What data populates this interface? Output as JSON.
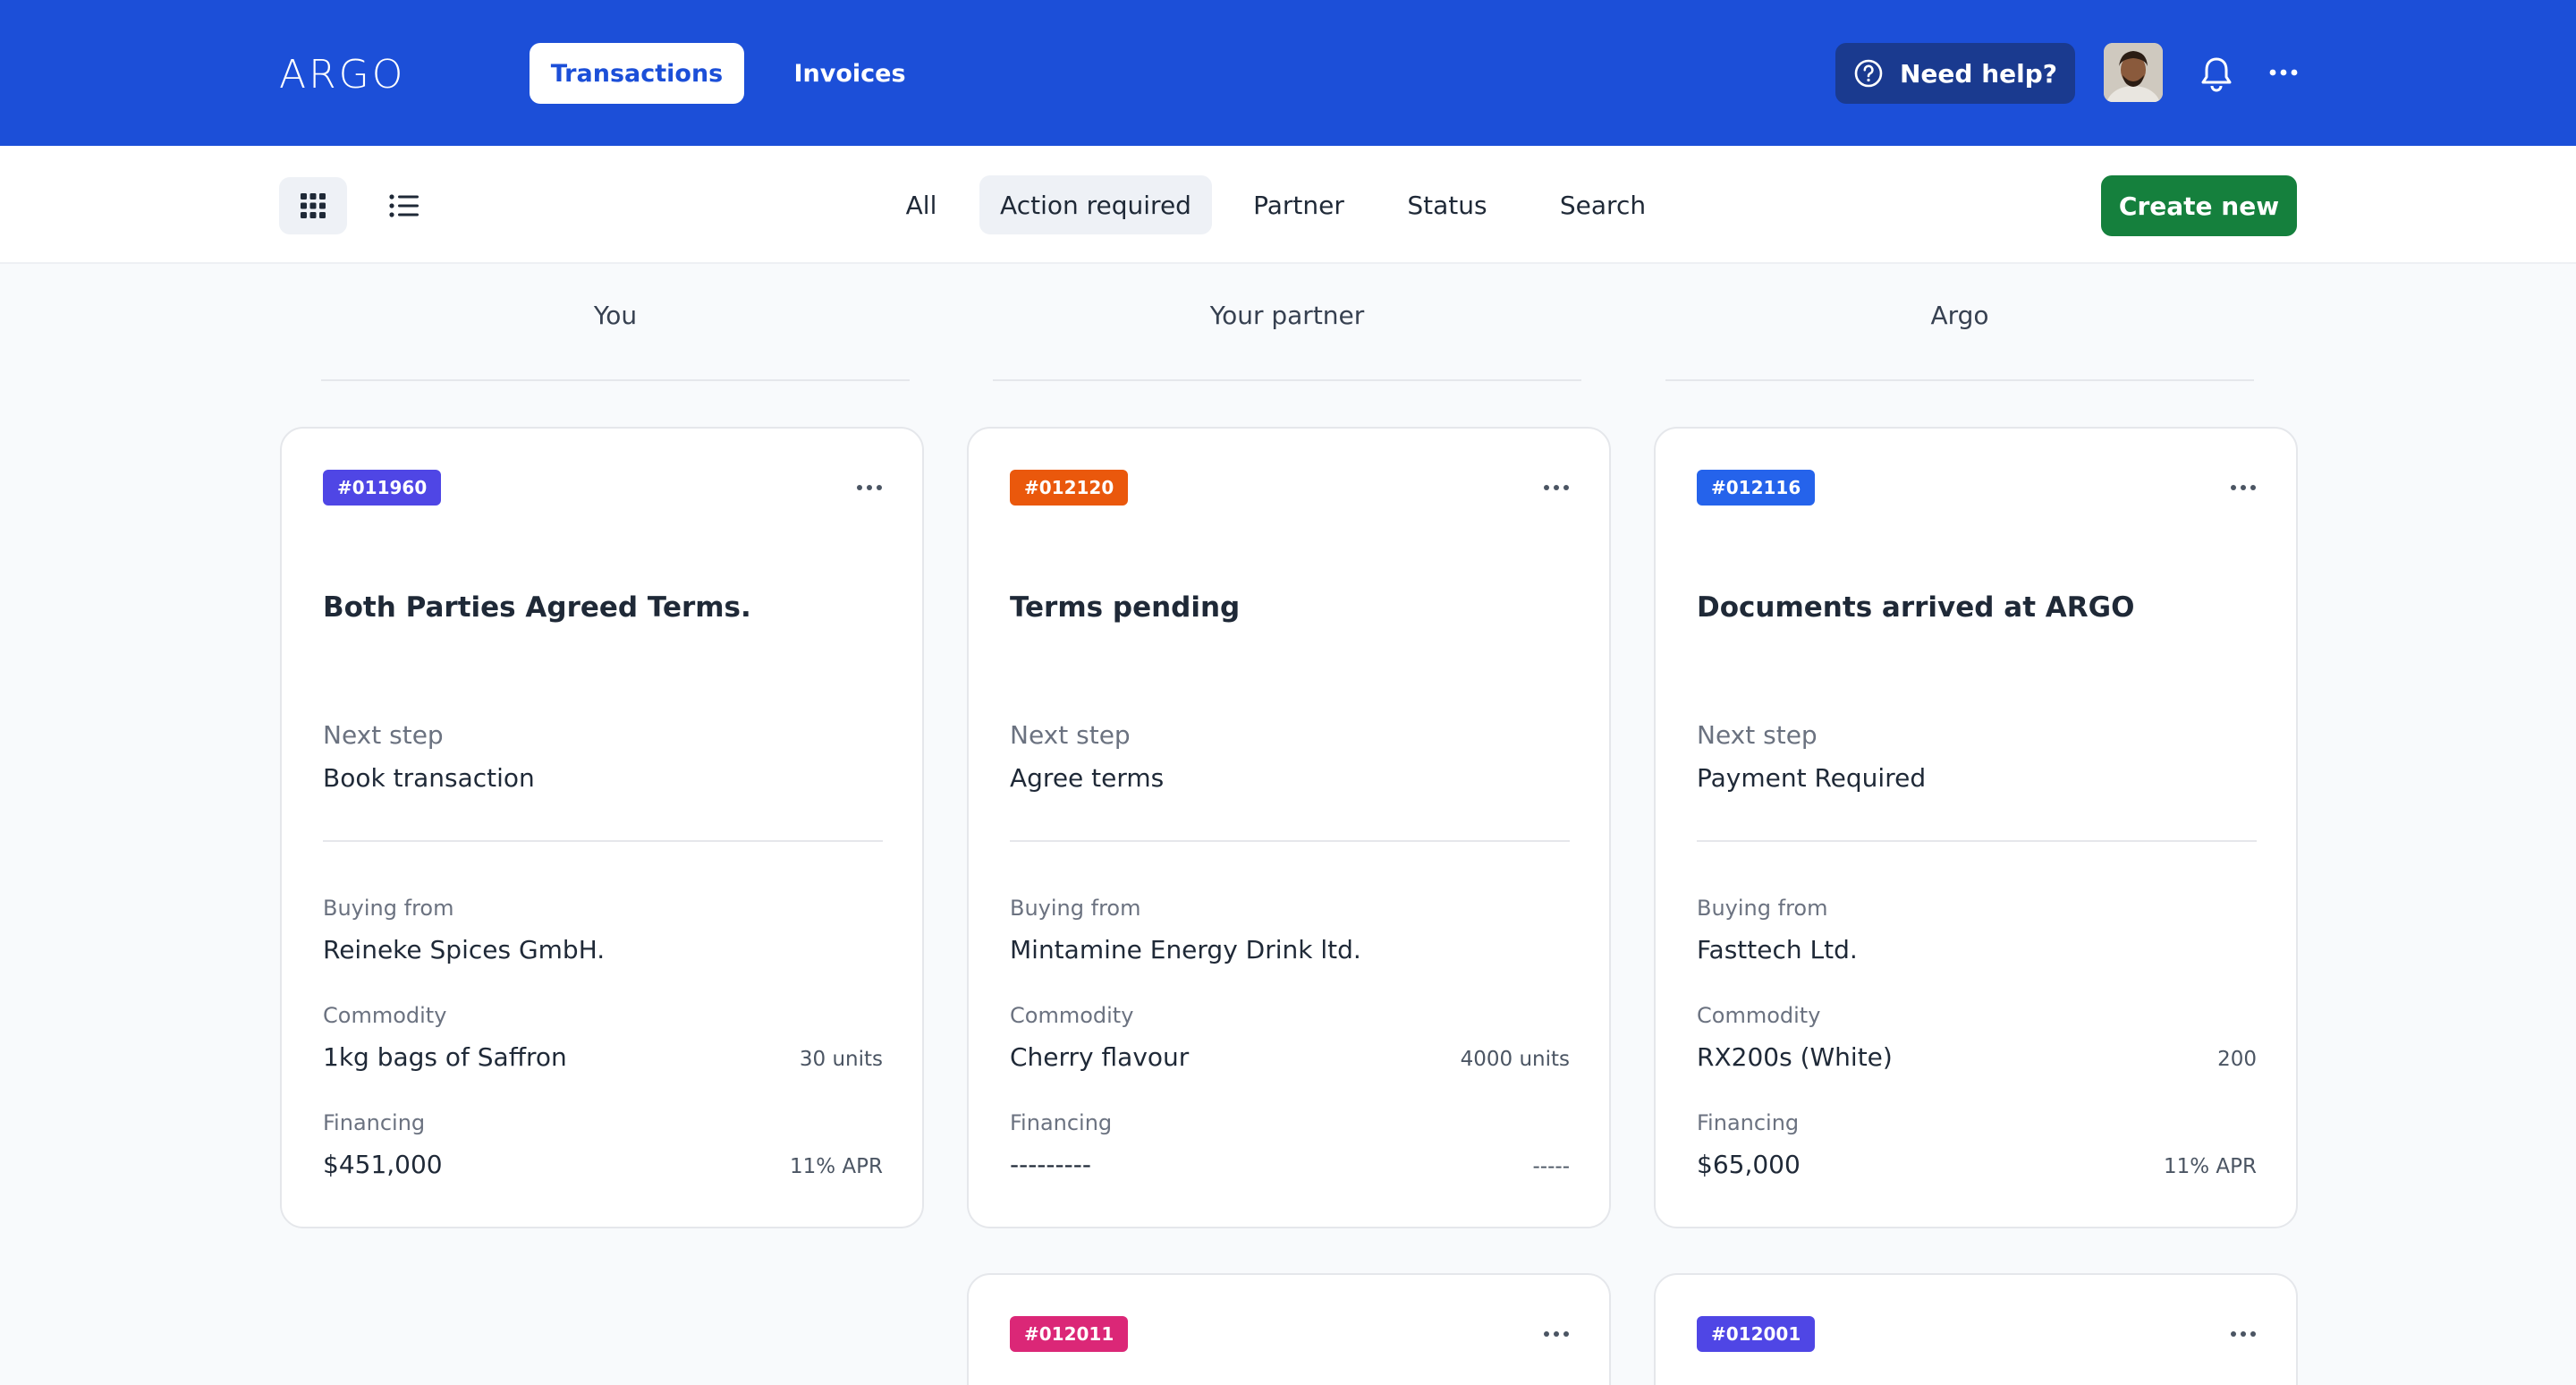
{
  "header": {
    "logo": "ARGO",
    "tabs": [
      {
        "label": "Transactions",
        "active": true
      },
      {
        "label": "Invoices",
        "active": false
      }
    ],
    "help_label": "Need help?",
    "brand_color": "#1c4fd8"
  },
  "toolbar": {
    "filters": [
      {
        "label": "All",
        "active": false
      },
      {
        "label": "Action required",
        "active": true
      },
      {
        "label": "Partner",
        "active": false
      },
      {
        "label": "Status",
        "active": false
      },
      {
        "label": "Search",
        "active": false
      }
    ],
    "create_label": "Create new"
  },
  "columns": [
    "You",
    "Your partner",
    "Argo"
  ],
  "labels": {
    "next_step": "Next step",
    "buying_from": "Buying from",
    "commodity": "Commodity",
    "financing": "Financing"
  },
  "cards": [
    {
      "id": "#011960",
      "badge_color": "#4f46e5",
      "title": "Both Parties Agreed Terms.",
      "next_step": "Book transaction",
      "buying_from": "Reineke Spices GmbH.",
      "commodity": "1kg bags of Saffron",
      "units": "30 units",
      "financing": "$451,000",
      "apr": "11% APR"
    },
    {
      "id": "#012120",
      "badge_color": "#ea580c",
      "title": "Terms pending",
      "next_step": "Agree terms",
      "buying_from": "Mintamine Energy Drink ltd.",
      "commodity": "Cherry flavour",
      "units": "4000 units",
      "financing": "---------",
      "apr": "-----"
    },
    {
      "id": "#012116",
      "badge_color": "#2563eb",
      "title": "Documents arrived at ARGO",
      "next_step": "Payment Required",
      "buying_from": "Fasttech Ltd.",
      "commodity": "RX200s (White)",
      "units": "200",
      "financing": "$65,000",
      "apr": "11% APR"
    },
    {
      "id": "#012011",
      "badge_color": "#db2777"
    },
    {
      "id": "#012001",
      "badge_color": "#4f46e5"
    }
  ]
}
